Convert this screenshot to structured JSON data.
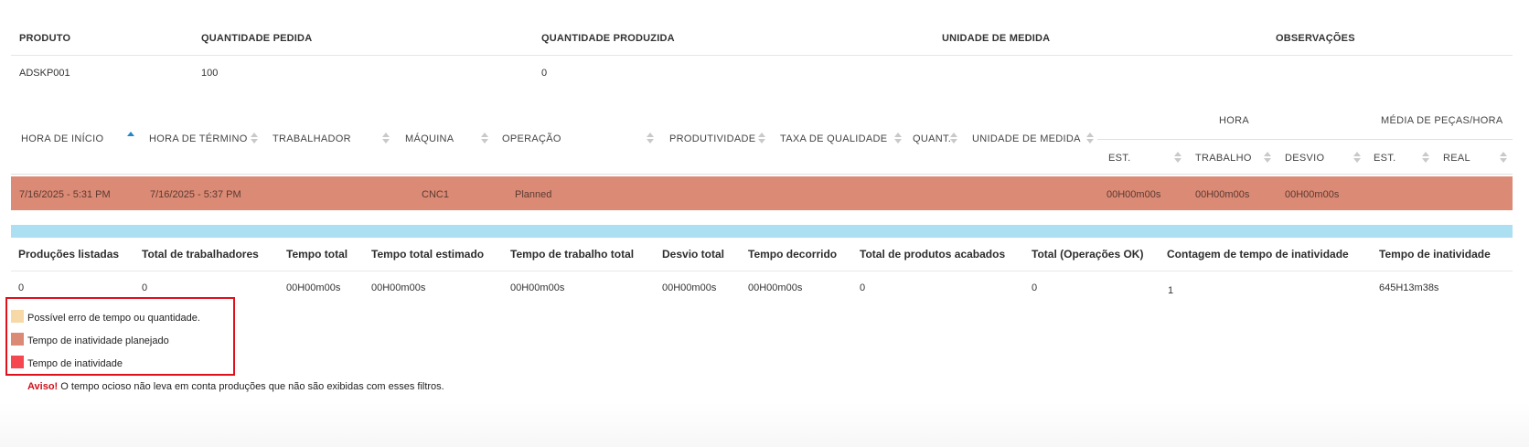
{
  "product_table": {
    "headers": [
      "PRODUTO",
      "QUANTIDADE PEDIDA",
      "QUANTIDADE PRODUZIDA",
      "UNIDADE DE MEDIDA",
      "OBSERVAÇÕES"
    ],
    "row": [
      "ADSKP001",
      "100",
      "0",
      "",
      ""
    ]
  },
  "detail_table": {
    "headers": {
      "start": "HORA DE INÍCIO",
      "end": "HORA DE TÉRMINO",
      "worker": "TRABALHADOR",
      "machine": "MÁQUINA",
      "operation": "OPERAÇÃO",
      "productivity": "PRODUTIVIDADE",
      "quality": "TAXA DE QUALIDADE",
      "qty": "QUANT.",
      "unit": "UNIDADE DE MEDIDA",
      "hora_group": "HORA",
      "media_group": "MÉDIA DE PEÇAS/HORA",
      "hora_est": "EST.",
      "hora_trabalho": "TRABALHO",
      "hora_desvio": "DESVIO",
      "media_est": "EST.",
      "media_real": "REAL"
    },
    "row": {
      "start": "7/16/2025 - 5:31 PM",
      "end": "7/16/2025 - 5:37 PM",
      "machine": "CNC1",
      "operation": "Planned",
      "hora_est": "00H00m00s",
      "hora_trabalho": "00H00m00s",
      "hora_desvio": "00H00m00s",
      "row_color": "#db8a75"
    }
  },
  "summary": {
    "headers": [
      "Produções listadas",
      "Total de trabalhadores",
      "Tempo total",
      "Tempo total estimado",
      "Tempo de trabalho total",
      "Desvio total",
      "Tempo decorrido",
      "Total de produtos acabados",
      "Total (Operações OK)",
      "Contagem de tempo de inatividade",
      "Tempo de inatividade"
    ],
    "values": [
      "0",
      "0",
      "00H00m00s",
      "00H00m00s",
      "00H00m00s",
      "00H00m00s",
      "00H00m00s",
      "0",
      "0",
      "1",
      "645H13m38s"
    ]
  },
  "legend": [
    {
      "label": "Possível erro de tempo ou quantidade.",
      "color": "#f6d9a7"
    },
    {
      "label": "Tempo de inatividade planejado",
      "color": "#db8a75"
    },
    {
      "label": "Tempo de inatividade",
      "color": "#f5474f"
    }
  ],
  "warning": {
    "prefix": "Aviso!",
    "text": " O tempo ocioso não leva em conta produções que não são exibidas com esses filtros."
  }
}
